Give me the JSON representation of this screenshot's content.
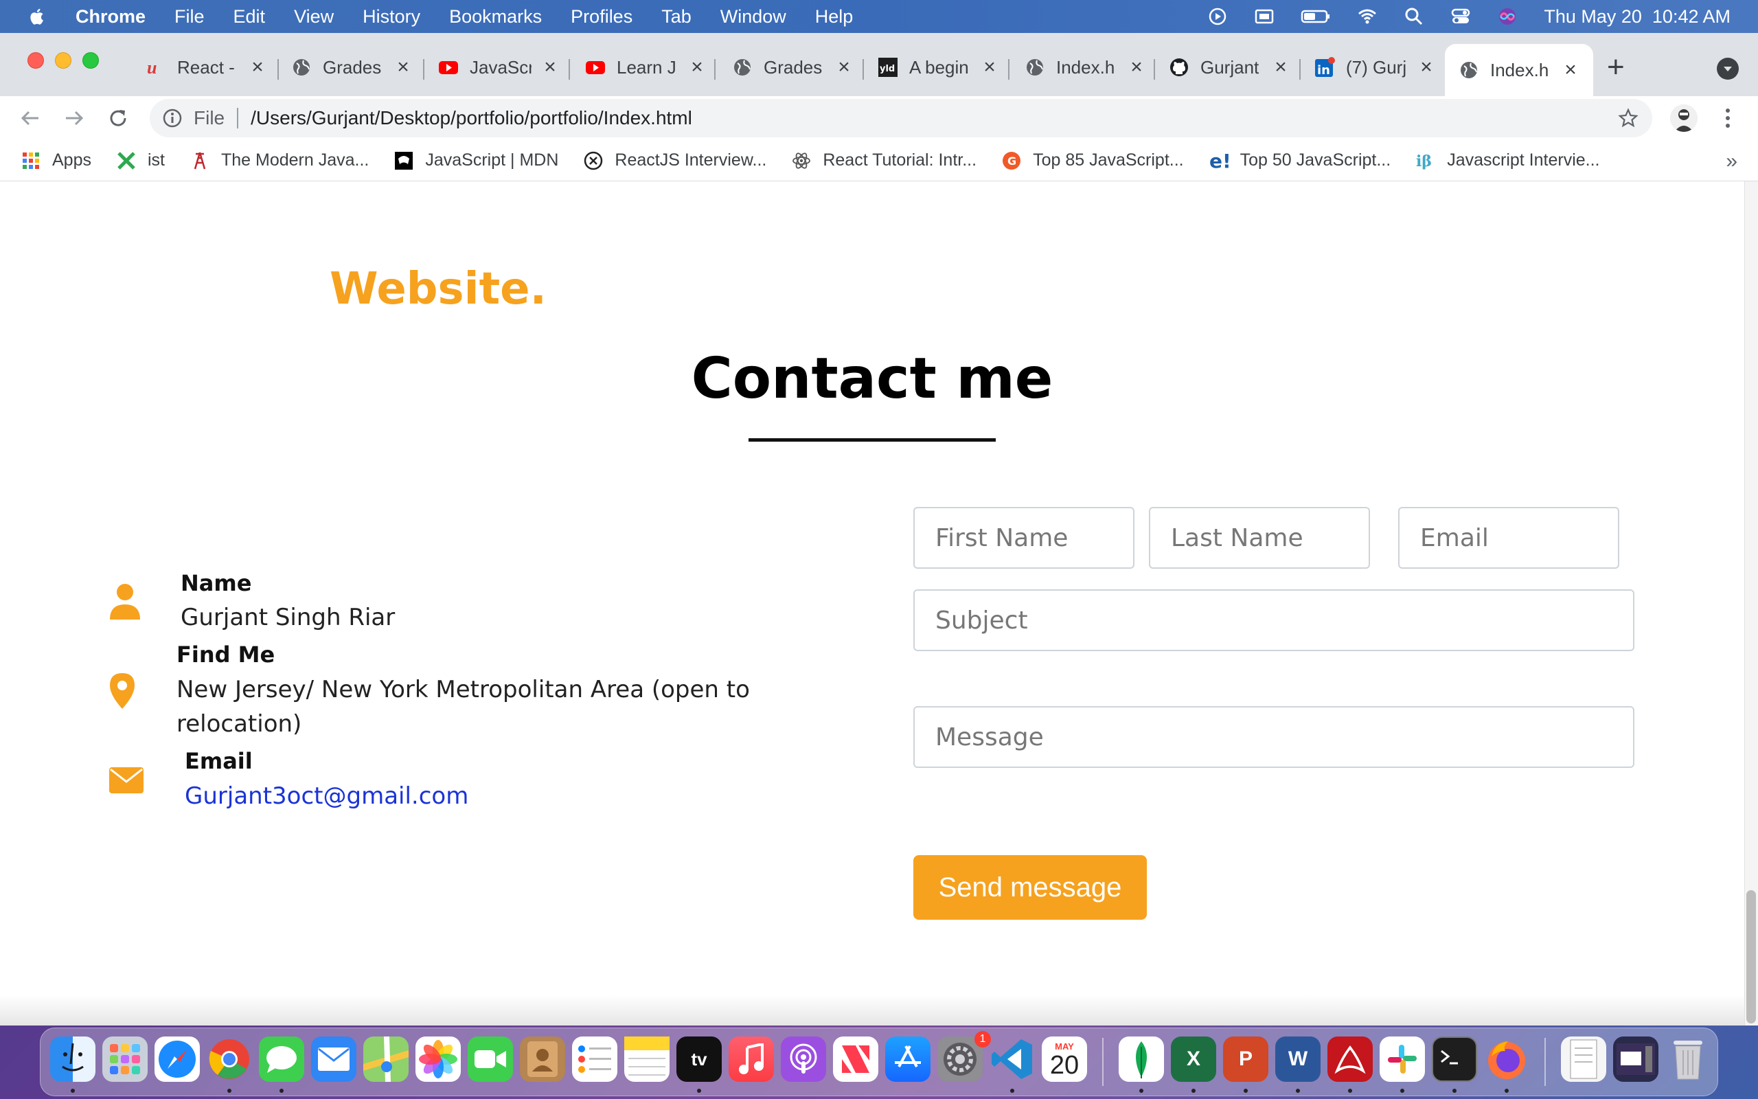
{
  "menubar": {
    "app_name": "Chrome",
    "items": [
      "File",
      "Edit",
      "View",
      "History",
      "Bookmarks",
      "Profiles",
      "Tab",
      "Window",
      "Help"
    ],
    "clock": "Thu May 20  10:42 AM"
  },
  "tabs": [
    {
      "title": "React -",
      "icon": "react-u-icon"
    },
    {
      "title": "Grades",
      "icon": "globe-icon"
    },
    {
      "title": "JavaScr",
      "icon": "youtube-icon"
    },
    {
      "title": "Learn J",
      "icon": "youtube-icon"
    },
    {
      "title": "Grades",
      "icon": "globe-icon"
    },
    {
      "title": "A begin",
      "icon": "yld-icon"
    },
    {
      "title": "Index.h",
      "icon": "globe-icon"
    },
    {
      "title": "Gurjant",
      "icon": "github-icon"
    },
    {
      "title": "(7) Gurj",
      "icon": "linkedin-icon"
    },
    {
      "title": "Index.h",
      "icon": "globe-icon",
      "active": true
    }
  ],
  "address_bar": {
    "scheme_label": "File",
    "url": "/Users/Gurjant/Desktop/portfolio/portfolio/Index.html"
  },
  "bookmarks": [
    {
      "label": "Apps",
      "icon": "apps-grid-icon"
    },
    {
      "label": "ist",
      "icon": "x-icon"
    },
    {
      "label": "The Modern Java...",
      "icon": "tower-icon"
    },
    {
      "label": "JavaScript | MDN",
      "icon": "mdn-icon"
    },
    {
      "label": "ReactJS Interview...",
      "icon": "circle-x-icon"
    },
    {
      "label": "React Tutorial: Intr...",
      "icon": "react-atom-icon"
    },
    {
      "label": "Top 85 JavaScript...",
      "icon": "orange-badge-icon"
    },
    {
      "label": "Top 50 JavaScript...",
      "icon": "e-icon"
    },
    {
      "label": "Javascript Intervie...",
      "icon": "ib-icon"
    }
  ],
  "page": {
    "website_heading": "Website.",
    "contact_title": "Contact me",
    "info": {
      "name_label": "Name",
      "name_value": "Gurjant Singh Riar",
      "location_label": "Find Me",
      "location_value": "New Jersey/ New York Metropolitan Area (open to relocation)",
      "email_label": "Email",
      "email_value": "Gurjant3oct@gmail.com"
    },
    "form": {
      "first_name_placeholder": "First Name",
      "last_name_placeholder": "Last Name",
      "email_placeholder": "Email",
      "subject_placeholder": "Subject",
      "message_placeholder": "Message",
      "send_label": "Send message"
    }
  },
  "colors": {
    "accent": "#f6a21e",
    "link": "#1a33d6"
  },
  "dock": {
    "calendar_month": "MAY",
    "calendar_day": "20",
    "settings_badge": "1",
    "apps": [
      "finder",
      "launchpad",
      "safari",
      "chrome",
      "messages",
      "mail",
      "maps",
      "photos",
      "facetime",
      "contacts",
      "reminders",
      "notes",
      "tv",
      "music",
      "podcasts",
      "news",
      "app-store",
      "system-preferences",
      "vscode",
      "calendar",
      "mongodb-compass",
      "excel",
      "powerpoint",
      "word",
      "acrobat",
      "slack",
      "terminal",
      "firefox"
    ],
    "tv_label": "tv"
  }
}
